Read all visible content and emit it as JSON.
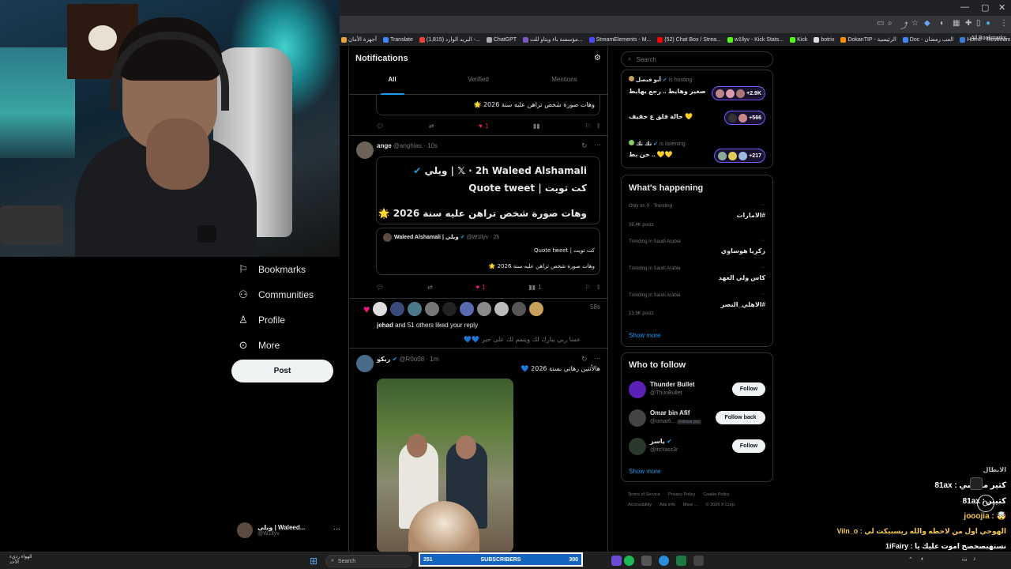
{
  "browser": {
    "bookmarks": [
      {
        "label": "أجهزة الأمان",
        "color": "#e8a33d"
      },
      {
        "label": "Translate",
        "color": "#4285f4"
      },
      {
        "label": "(1,815) البريد الوارد -...",
        "color": "#ea4335"
      },
      {
        "label": "ChatGPT",
        "color": "#aaaaaa"
      },
      {
        "label": "مؤسسة باء ويتاو للت...",
        "color": "#7e57c2"
      },
      {
        "label": "StreamElements - M...",
        "color": "#4a4aff"
      },
      {
        "label": "(52) Chat Box / Strea...",
        "color": "#ff0000"
      },
      {
        "label": "w1llyv - Kick Stats...",
        "color": "#53fc18"
      },
      {
        "label": "Kick",
        "color": "#53fc18"
      },
      {
        "label": "botrix",
        "color": "#dddddd"
      },
      {
        "label": "DokanTIP - الرئيسية",
        "color": "#ff8a00"
      },
      {
        "label": "Doc - العب رمضان",
        "color": "#4285f4"
      },
      {
        "label": "Home - Restream",
        "color": "#3a7bd5"
      }
    ],
    "all_bookmarks": "All Bookmarks"
  },
  "nav": {
    "items": [
      {
        "label": "Bookmarks",
        "icon": "bookmark-icon"
      },
      {
        "label": "Communities",
        "icon": "communities-icon"
      },
      {
        "label": "Profile",
        "icon": "profile-icon"
      },
      {
        "label": "More",
        "icon": "more-icon"
      }
    ],
    "post_label": "Post",
    "account": {
      "name": "ويلي | Waleed...",
      "handle": "@W1llyv"
    }
  },
  "main": {
    "title": "Notifications",
    "tabs": [
      "All",
      "Verified",
      "Mentions"
    ],
    "top_quote_text": "وهات صورة شخص تراهن عليه سنة 2026 🌟",
    "top_like_count": "1",
    "tweet1": {
      "name": "ange",
      "handle": "@anghias",
      "time": "· 10s",
      "quote_author": "Waleed Alshamali | ويلي",
      "quote_time": "· 2h",
      "quote_line1": "كت تويت | Quote tweet",
      "quote_line2": "وهات صورة شخص تراهن عليه سنة 2026 🌟",
      "inner_author": "Waleed Alshamali | ويلي",
      "inner_handle": "@W1llyv · 2h",
      "inner_line1": "كت تويت | Quote tweet",
      "inner_line2": "وهات صورة شخص تراهن عليه سنة 2026 🌟",
      "likes": "1",
      "views": "1"
    },
    "like_notif": {
      "time": "58s",
      "text_bold": "jehad",
      "text_rest": " and 51 others liked your reply",
      "reply": "عسا ربي يبارك لك ويتمم لك على خير 💙💙"
    },
    "tweet2": {
      "name": "ريكو",
      "handle": "@R0o08",
      "time": "· 1m",
      "text": "هالأثنين رهاني بسنة 2026 💙"
    }
  },
  "right": {
    "search_placeholder": "Search",
    "spaces": [
      {
        "host": "أبو فيصل",
        "status": "is hosting",
        "title": "صغير وهايط .. رجع يهايط",
        "count": "+2.9K"
      },
      {
        "host": "",
        "status": "",
        "title": "حالة قلق ع خفيف 💛",
        "count": "+566"
      },
      {
        "host": "تك تك",
        "status": "is listening",
        "title": "خن بط .. 💛💛",
        "count": "+217"
      }
    ],
    "happening_title": "What's happening",
    "trends": [
      {
        "meta": "Only on X · Trending",
        "name": "#الامارات",
        "posts": "38.4K posts"
      },
      {
        "meta": "Trending in Saudi Arabia",
        "name": "زكريا هوساوي",
        "posts": ""
      },
      {
        "meta": "Trending in Saudi Arabia",
        "name": "كاس ولي العهد",
        "posts": ""
      },
      {
        "meta": "Trending in Saudi Arabia",
        "name": "#الاهلي_النصر",
        "posts": "13.9K posts"
      }
    ],
    "show_more": "Show more",
    "who_to_follow_title": "Who to follow",
    "follow_suggestions": [
      {
        "name": "Thunder Bullet",
        "handle": "@ThunBullet",
        "button": "Follow",
        "follows_you": ""
      },
      {
        "name": "Omar bin Afif",
        "handle": "@omarfi...",
        "button": "Follow back",
        "follows_you": "Follows you"
      },
      {
        "name": "ياسر",
        "handle": "@itsYass3r",
        "button": "Follow",
        "follows_you": ""
      }
    ],
    "show_more_2": "Show more",
    "footer": [
      "Terms of Service",
      "Privacy Policy",
      "Cookie Policy",
      "Accessibility",
      "Ads info",
      "More ...",
      "© 2026 X Corp."
    ]
  },
  "chat": {
    "lines": [
      {
        "text": "الابطال",
        "color": "#bbbbbb"
      },
      {
        "text": "كثير مونسي : 81ax",
        "color": "#ffffff"
      },
      {
        "text": "كثيير : 81ax",
        "color": "#ffffff"
      },
      {
        "text": "🤯 : jooojia",
        "color": "#f0c850"
      },
      {
        "text": "الهوجي اول من لاحظه والله ريسبيكت لي : Viln_o",
        "color": "#f0c850"
      },
      {
        "text": "نستهبصخصخ اموت عليك يا : 1iFairy",
        "color": "#ffffff"
      }
    ]
  },
  "taskbar": {
    "weather_line1": "الهواء رديء",
    "weather_line2": "الأحد",
    "search_label": "Search",
    "subs_count": "251",
    "subs_label": "SUBSCRIBERS",
    "subs_goal": "300"
  }
}
